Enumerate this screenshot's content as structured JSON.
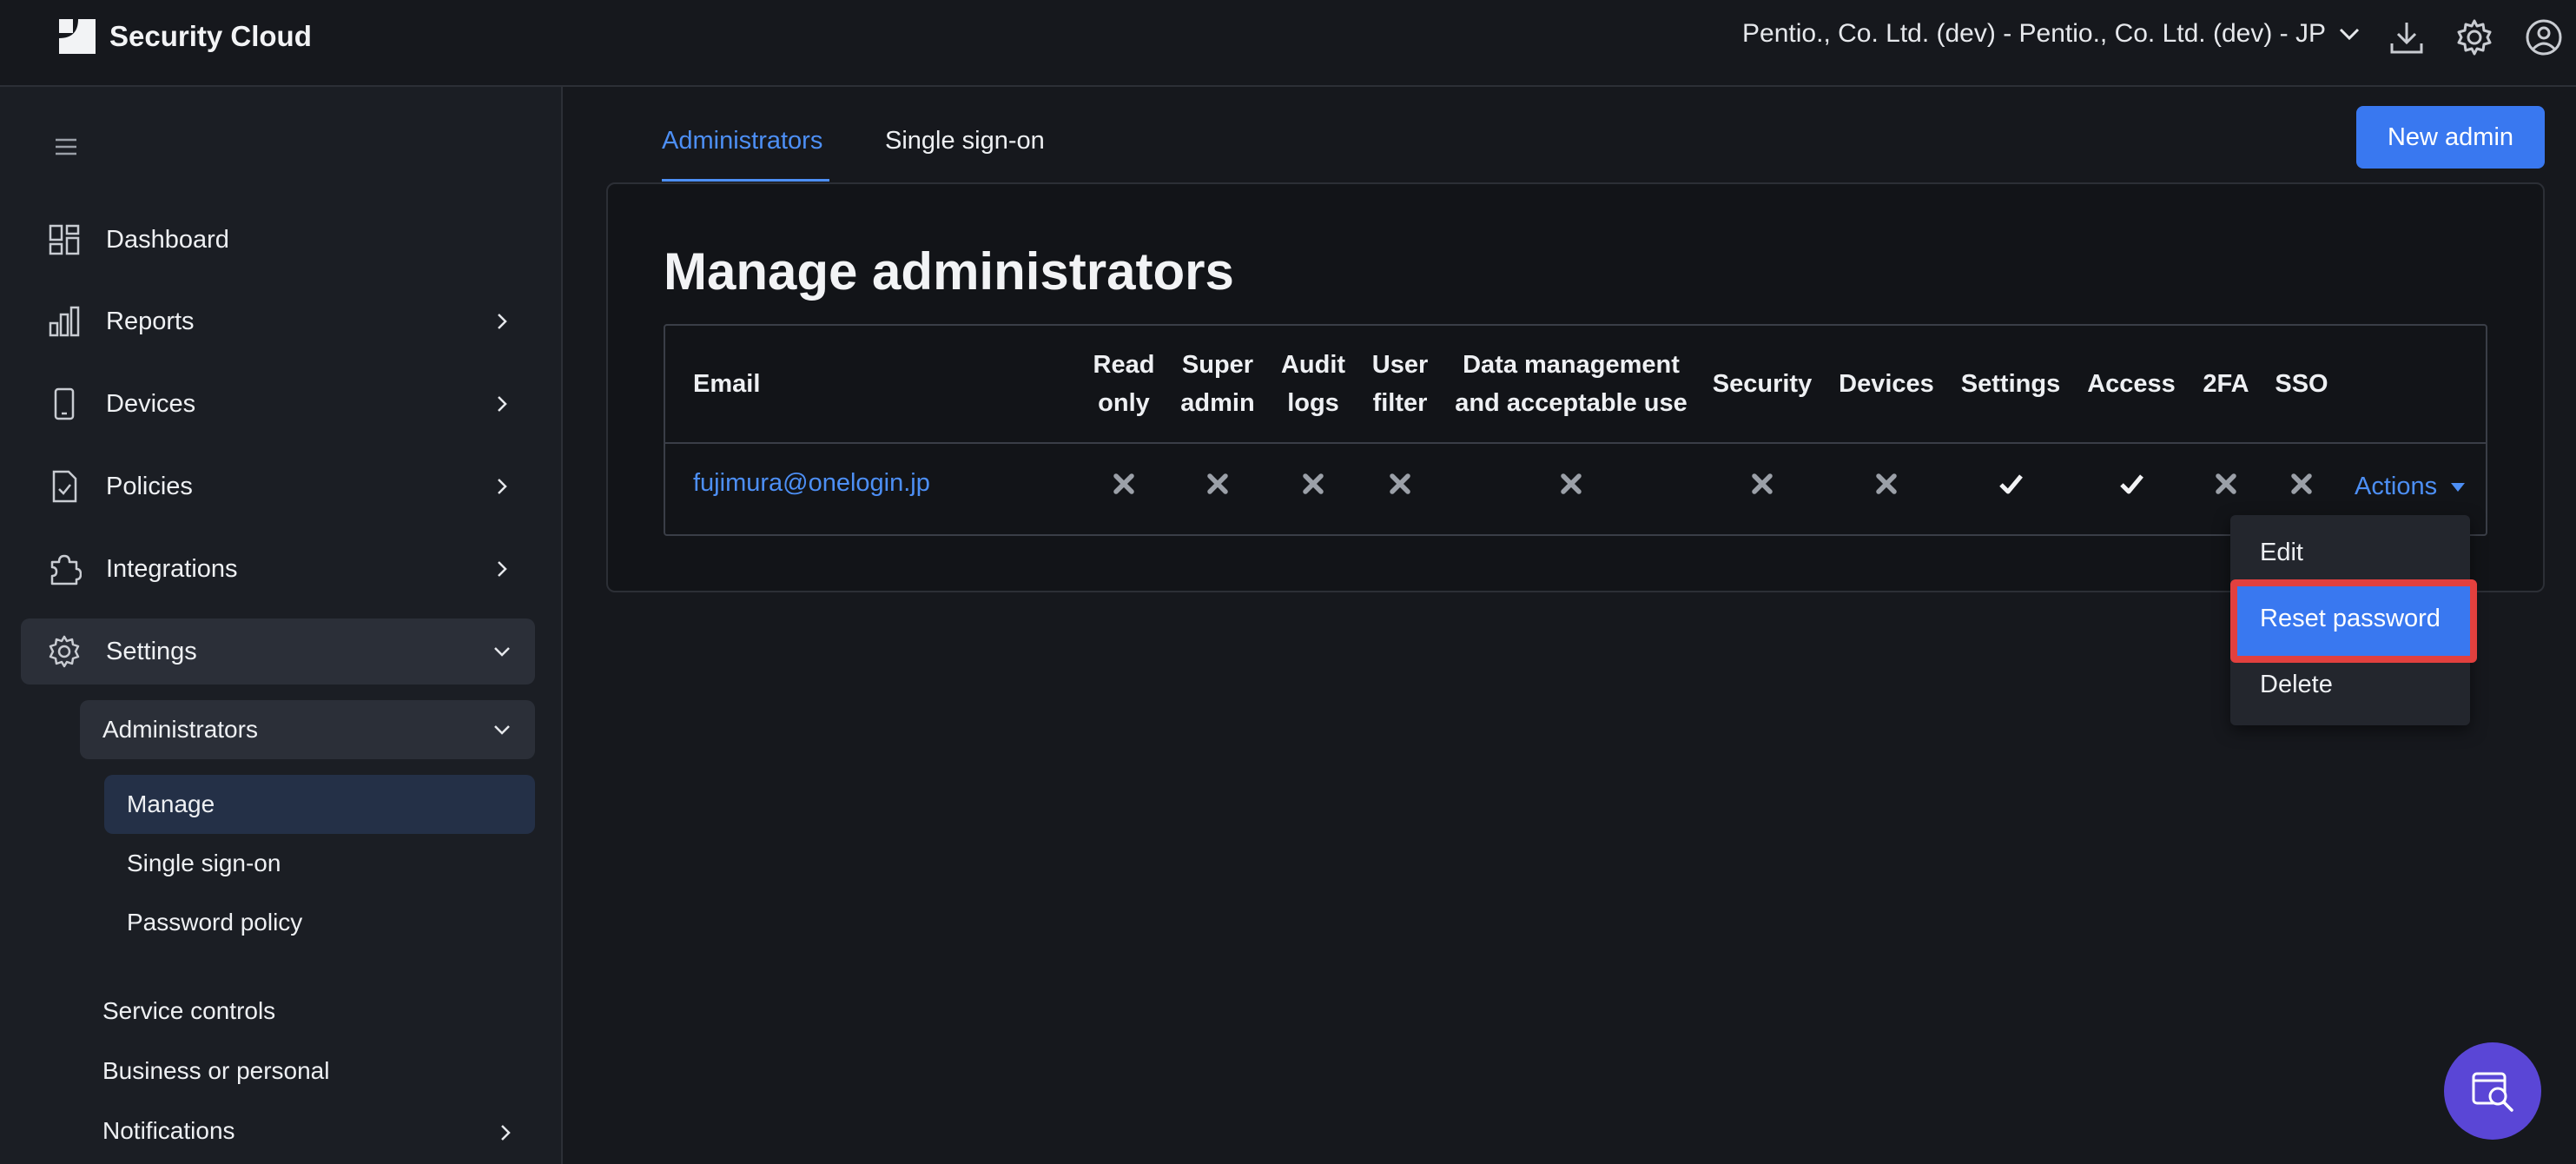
{
  "app": {
    "name": "Security Cloud"
  },
  "header": {
    "tenant": "Pentio., Co. Ltd. (dev) - Pentio., Co. Ltd. (dev) - JP",
    "icons": [
      "download-icon",
      "gear-icon",
      "user-circle-icon"
    ]
  },
  "sidebar": {
    "items": [
      {
        "label": "Dashboard",
        "icon": "dashboard-icon"
      },
      {
        "label": "Reports",
        "icon": "bar-chart-icon"
      },
      {
        "label": "Devices",
        "icon": "phone-icon"
      },
      {
        "label": "Policies",
        "icon": "document-check-icon"
      },
      {
        "label": "Integrations",
        "icon": "puzzle-icon"
      },
      {
        "label": "Settings",
        "icon": "gear-icon"
      }
    ],
    "settings_sub": {
      "administrators": "Administrators",
      "admin_children": [
        "Manage",
        "Single sign-on",
        "Password policy"
      ],
      "others": [
        "Service controls",
        "Business or personal",
        "Notifications"
      ]
    }
  },
  "tabs": [
    "Administrators",
    "Single sign-on"
  ],
  "new_admin_label": "New admin",
  "page_title": "Manage administrators",
  "table": {
    "headers": {
      "email": "Email",
      "read_only": [
        "Read",
        "only"
      ],
      "super_admin": [
        "Super",
        "admin"
      ],
      "audit_logs": [
        "Audit",
        "logs"
      ],
      "user_filter": [
        "User",
        "filter"
      ],
      "data_mgmt": [
        "Data management",
        "and acceptable use"
      ],
      "security": "Security",
      "devices": "Devices",
      "settings": "Settings",
      "access": "Access",
      "twofa": "2FA",
      "sso": "SSO"
    },
    "rows": [
      {
        "email": "fujimura@onelogin.jp",
        "permissions": {
          "read_only": false,
          "super_admin": false,
          "audit_logs": false,
          "user_filter": false,
          "data_mgmt": false,
          "security": false,
          "devices": false,
          "settings": true,
          "access": true,
          "twofa": false,
          "sso": false
        },
        "actions_label": "Actions"
      }
    ]
  },
  "actions_menu": {
    "items": [
      "Edit",
      "Reset password",
      "Delete"
    ],
    "highlighted": "Reset password"
  },
  "colors": {
    "accent": "#3978f0",
    "link": "#4d8ff5",
    "highlight_border": "#e2403e",
    "background": "#16181d",
    "fab": "#5a46d6"
  }
}
